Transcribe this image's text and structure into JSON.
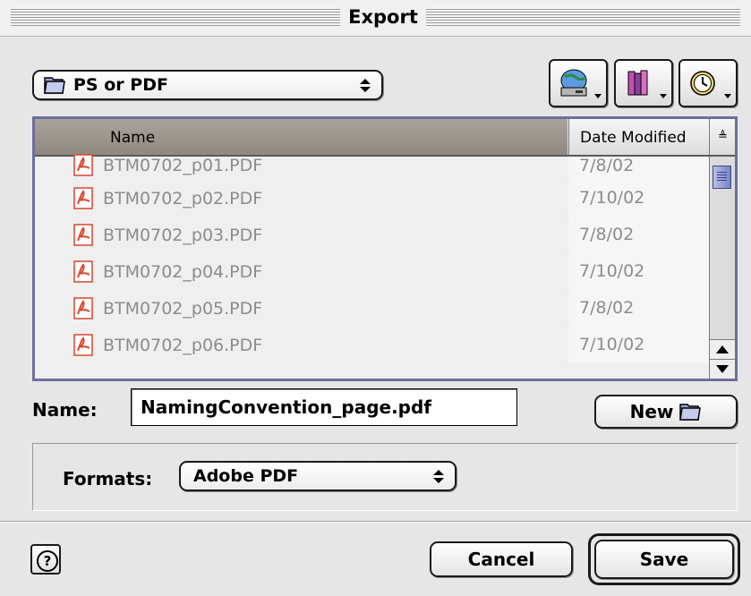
{
  "window": {
    "title": "Export"
  },
  "location_popup": {
    "label": "PS or PDF"
  },
  "toolbar": {
    "shortcuts_icon": "disk-globe-icon",
    "favorites_icon": "books-icon",
    "recent_icon": "clock-icon"
  },
  "file_list": {
    "columns": {
      "name": "Name",
      "date": "Date Modified",
      "sort": "≜"
    },
    "rows": [
      {
        "name": "BTM0702_p01.PDF",
        "date": "7/8/02"
      },
      {
        "name": "BTM0702_p02.PDF",
        "date": "7/10/02"
      },
      {
        "name": "BTM0702_p03.PDF",
        "date": "7/8/02"
      },
      {
        "name": "BTM0702_p04.PDF",
        "date": "7/10/02"
      },
      {
        "name": "BTM0702_p05.PDF",
        "date": "7/8/02"
      },
      {
        "name": "BTM0702_p06.PDF",
        "date": "7/10/02"
      }
    ]
  },
  "name_field": {
    "label": "Name:",
    "value": "NamingConvention_page.pdf"
  },
  "new_folder_button": {
    "label": "New"
  },
  "formats": {
    "label": "Formats:",
    "value": "Adobe PDF"
  },
  "buttons": {
    "cancel": "Cancel",
    "save": "Save",
    "help": "?"
  },
  "colors": {
    "list_border": "#6b6f9e",
    "header_selected": "#9a948d",
    "pdf_icon": "#d9462e"
  }
}
